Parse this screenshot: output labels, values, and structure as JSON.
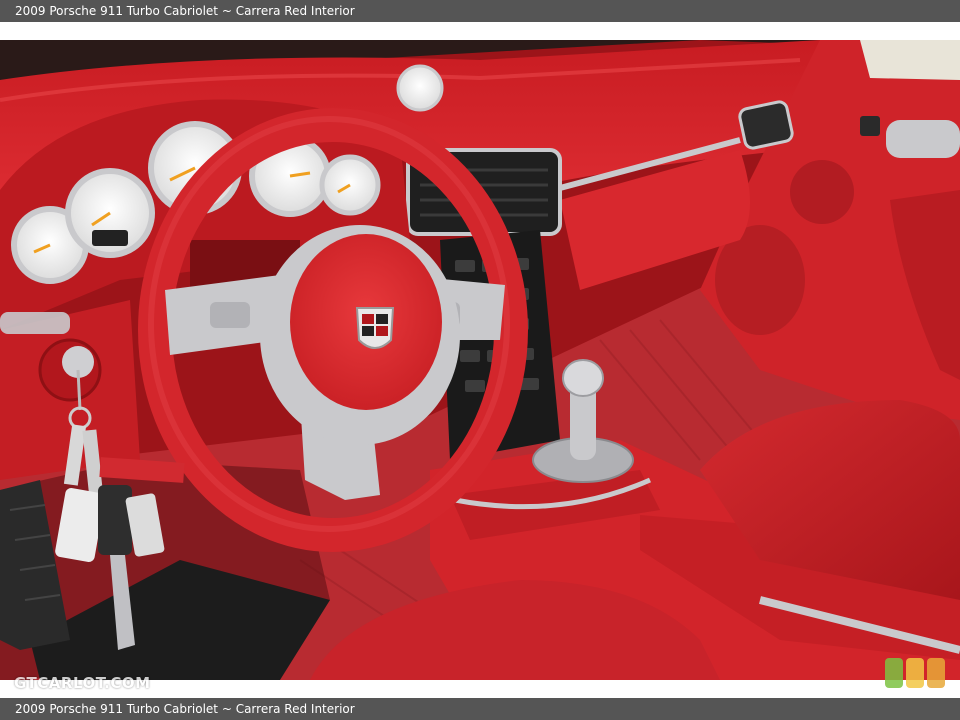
{
  "header": {
    "caption": "2009 Porsche 911 Turbo Cabriolet ~ Carrera Red Interior"
  },
  "footer": {
    "caption": "2009 Porsche 911 Turbo Cabriolet ~ Carrera Red Interior"
  },
  "photo": {
    "subject": "Porsche 911 red leather interior with steering wheel, gauges and center console",
    "watermark": "GTCARLOT.COM",
    "badge_colors": [
      "#7dc242",
      "#f2c744",
      "#e8a838"
    ]
  },
  "colors": {
    "leather_red": "#d4262b",
    "leather_shadow": "#8f1014",
    "carpet": "#b8282e",
    "silver": "#c9c9cc",
    "caption_bar": "#555555"
  }
}
